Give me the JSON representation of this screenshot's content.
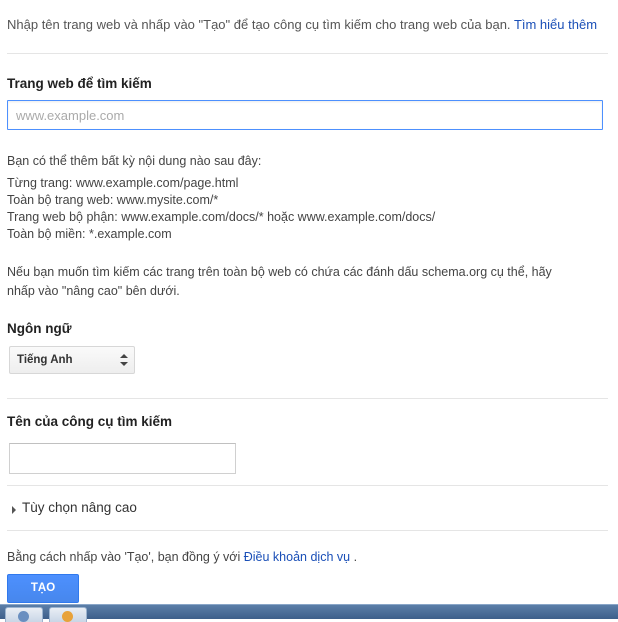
{
  "intro": {
    "text": "Nhập tên trang web và nhấp vào \"Tạo\" để tạo công cụ tìm kiếm cho trang web của bạn.",
    "link": "Tìm hiểu thêm"
  },
  "sites": {
    "label": "Trang web để tìm kiếm",
    "placeholder": "www.example.com",
    "value": ""
  },
  "help": {
    "intro": "Bạn có thể thêm bất kỳ nội dung nào sau đây:",
    "lines": [
      "Từng trang: www.example.com/page.html",
      "Toàn bộ trang web: www.mysite.com/*",
      "Trang web bộ phận: www.example.com/docs/* hoặc www.example.com/docs/",
      "Toàn bộ miền: *.example.com"
    ],
    "schema": [
      "Nếu bạn muốn tìm kiếm các trang trên toàn bộ web có chứa các đánh dấu schema.org cụ thể, hãy",
      "nhấp vào \"nâng cao\" bên dưới."
    ]
  },
  "language": {
    "label": "Ngôn ngữ",
    "selected": "Tiếng Anh",
    "icon": "updown-arrows-icon"
  },
  "engine_name": {
    "label": "Tên của công cụ tìm kiếm",
    "value": ""
  },
  "advanced": {
    "label": "Tùy chọn nâng cao",
    "icon": "triangle-right-icon"
  },
  "terms": {
    "prefix": "Bằng cách nhấp vào 'Tạo', bạn đồng ý với",
    "link": "Điều khoản dịch vụ",
    "suffix": "."
  },
  "create_button": {
    "label": "TẠO"
  },
  "colors": {
    "accent": "#4d90fe",
    "link": "#1a4fb7"
  }
}
